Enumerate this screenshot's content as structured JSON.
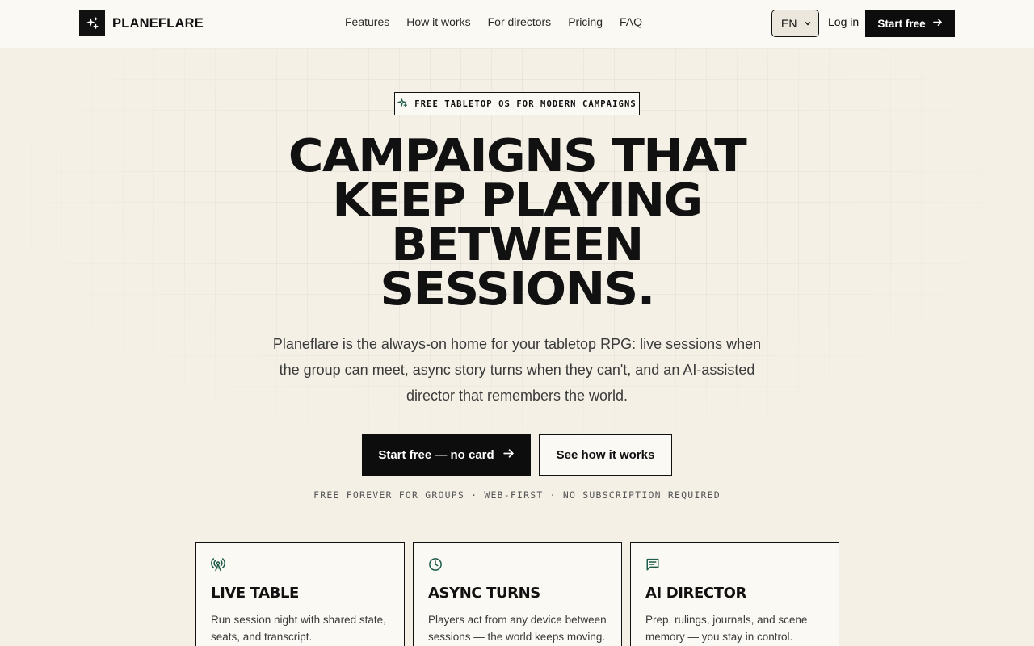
{
  "brand": {
    "name": "PLANEFLARE"
  },
  "nav": {
    "links": [
      "Features",
      "How it works",
      "For directors",
      "Pricing",
      "FAQ"
    ],
    "language": "EN",
    "login": "Log in",
    "start": "Start free"
  },
  "hero": {
    "badge": "FREE TABLETOP OS FOR MODERN CAMPAIGNS",
    "headline": [
      "CAMPAIGNS THAT",
      "KEEP PLAYING",
      "BETWEEN",
      "SESSIONS."
    ],
    "lede": "Planeflare is the always-on home for your tabletop RPG: live sessions when the group can meet, async story turns when they can't, and an AI-assisted director that remembers the world.",
    "cta_primary": "Start free — no card",
    "cta_secondary": "See how it works",
    "fineprint": "FREE FOREVER FOR GROUPS · WEB-FIRST · NO SUBSCRIPTION REQUIRED"
  },
  "features": [
    {
      "icon": "broadcast-icon",
      "title": "LIVE TABLE",
      "desc": "Run session night with shared state, seats, and transcript."
    },
    {
      "icon": "clock-icon",
      "title": "ASYNC TURNS",
      "desc": "Players act from any device between sessions — the world keeps moving."
    },
    {
      "icon": "message-icon",
      "title": "AI DIRECTOR",
      "desc": "Prep, rulings, journals, and scene memory — you stay in control."
    }
  ],
  "colors": {
    "accent": "#1f5c4a",
    "ink": "#111111",
    "background": "#f4f0e6",
    "surface": "#fbf9f3"
  }
}
